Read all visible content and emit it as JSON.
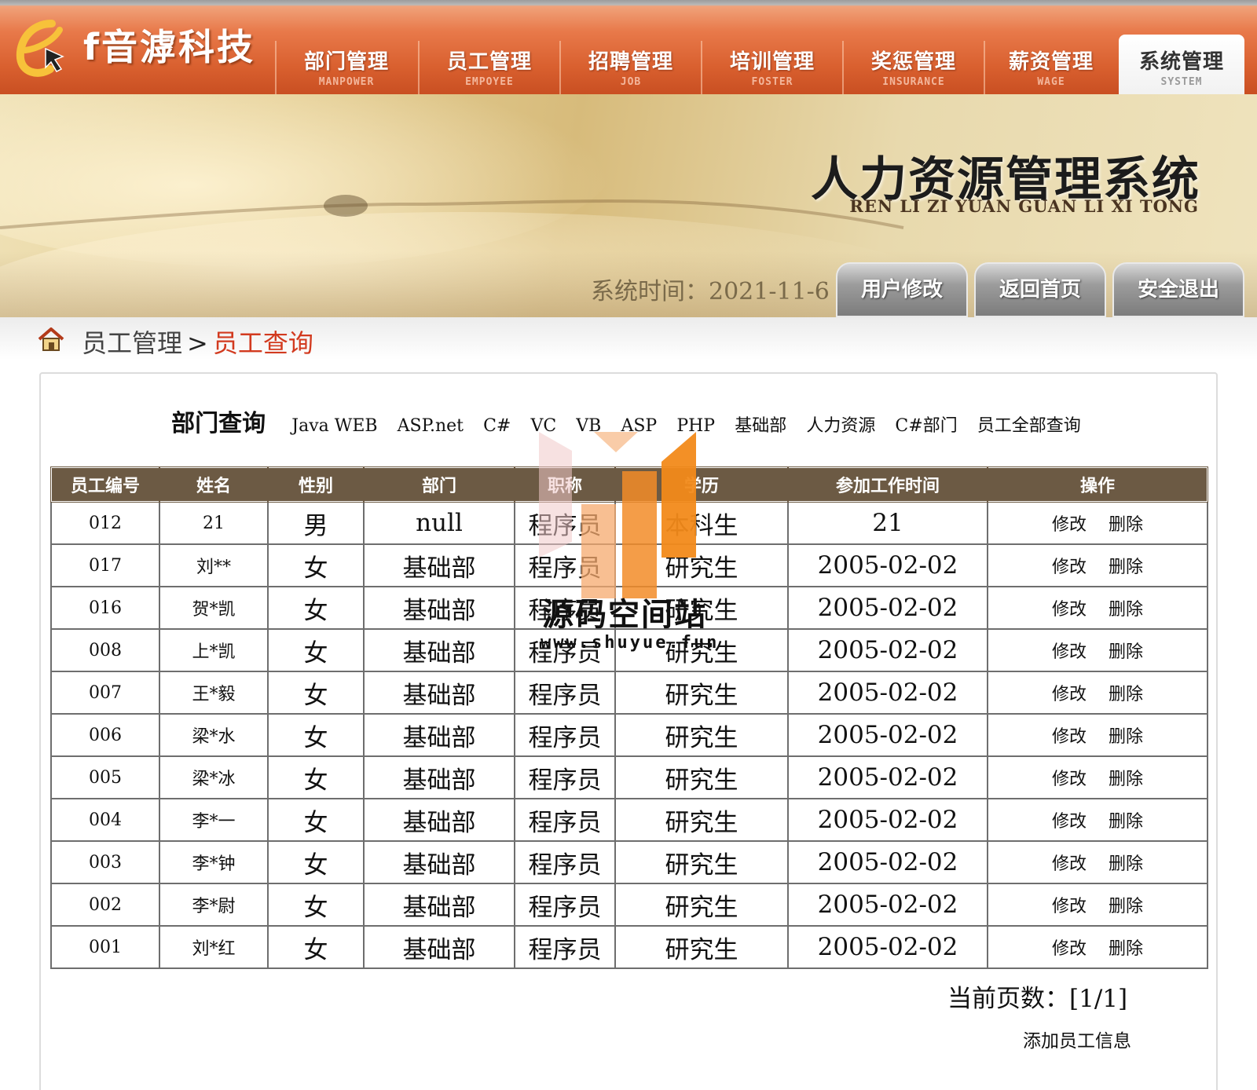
{
  "brand": {
    "name": "f音滹科技",
    "logo_letter": "e"
  },
  "nav": [
    {
      "zh": "部门管理",
      "en": "MANPOWER"
    },
    {
      "zh": "员工管理",
      "en": "EMPOYEE"
    },
    {
      "zh": "招聘管理",
      "en": "JOB"
    },
    {
      "zh": "培训管理",
      "en": "FOSTER"
    },
    {
      "zh": "奖惩管理",
      "en": "INSURANCE"
    },
    {
      "zh": "薪资管理",
      "en": "WAGE"
    },
    {
      "zh": "系统管理",
      "en": "SYSTEM",
      "active": true
    }
  ],
  "banner": {
    "title": "人力资源管理系统",
    "pinyin": "REN LI ZI YUAN GUAN LI XI TONG",
    "system_time": "系统时间：2021-11-6",
    "buttons": [
      "用户修改",
      "返回首页",
      "安全退出"
    ]
  },
  "breadcrumb": {
    "parent": "员工管理",
    "separator": ">",
    "current": "员工查询"
  },
  "dept_query": {
    "label": "部门查询",
    "links": [
      "Java WEB",
      "ASP.net",
      "C#",
      "VC",
      "VB",
      "ASP",
      "PHP",
      "基础部",
      "人力资源",
      "C#部门",
      "员工全部查询"
    ]
  },
  "table": {
    "headers": [
      "员工编号",
      "姓名",
      "性别",
      "部门",
      "职称",
      "学历",
      "参加工作时间",
      "操作"
    ],
    "rows": [
      {
        "id": "012",
        "name": "21",
        "gender": "男",
        "dept": "null",
        "title": "程序员",
        "edu": "本科生",
        "date": "21"
      },
      {
        "id": "017",
        "name": "刘**",
        "gender": "女",
        "dept": "基础部",
        "title": "程序员",
        "edu": "研究生",
        "date": "2005-02-02"
      },
      {
        "id": "016",
        "name": "贺*凯",
        "gender": "女",
        "dept": "基础部",
        "title": "程序员",
        "edu": "研究生",
        "date": "2005-02-02"
      },
      {
        "id": "008",
        "name": "上*凯",
        "gender": "女",
        "dept": "基础部",
        "title": "程序员",
        "edu": "研究生",
        "date": "2005-02-02"
      },
      {
        "id": "007",
        "name": "王*毅",
        "gender": "女",
        "dept": "基础部",
        "title": "程序员",
        "edu": "研究生",
        "date": "2005-02-02"
      },
      {
        "id": "006",
        "name": "梁*水",
        "gender": "女",
        "dept": "基础部",
        "title": "程序员",
        "edu": "研究生",
        "date": "2005-02-02"
      },
      {
        "id": "005",
        "name": "梁*冰",
        "gender": "女",
        "dept": "基础部",
        "title": "程序员",
        "edu": "研究生",
        "date": "2005-02-02"
      },
      {
        "id": "004",
        "name": "李*一",
        "gender": "女",
        "dept": "基础部",
        "title": "程序员",
        "edu": "研究生",
        "date": "2005-02-02"
      },
      {
        "id": "003",
        "name": "李*钟",
        "gender": "女",
        "dept": "基础部",
        "title": "程序员",
        "edu": "研究生",
        "date": "2005-02-02"
      },
      {
        "id": "002",
        "name": "李*尉",
        "gender": "女",
        "dept": "基础部",
        "title": "程序员",
        "edu": "研究生",
        "date": "2005-02-02"
      },
      {
        "id": "001",
        "name": "刘*红",
        "gender": "女",
        "dept": "基础部",
        "title": "程序员",
        "edu": "研究生",
        "date": "2005-02-02"
      }
    ],
    "op_edit": "修改",
    "op_delete": "删除"
  },
  "pager": {
    "text": "当前页数：[1/1]"
  },
  "add_link": "添加员工信息",
  "watermark": {
    "text": "源码空间站",
    "url": "www.shuyue.fun"
  },
  "colors": {
    "nav_orange": "#d9602f",
    "table_header": "#6c5a44",
    "crumb_current": "#d23a1f",
    "watermark_orange": "#f28a1a"
  }
}
